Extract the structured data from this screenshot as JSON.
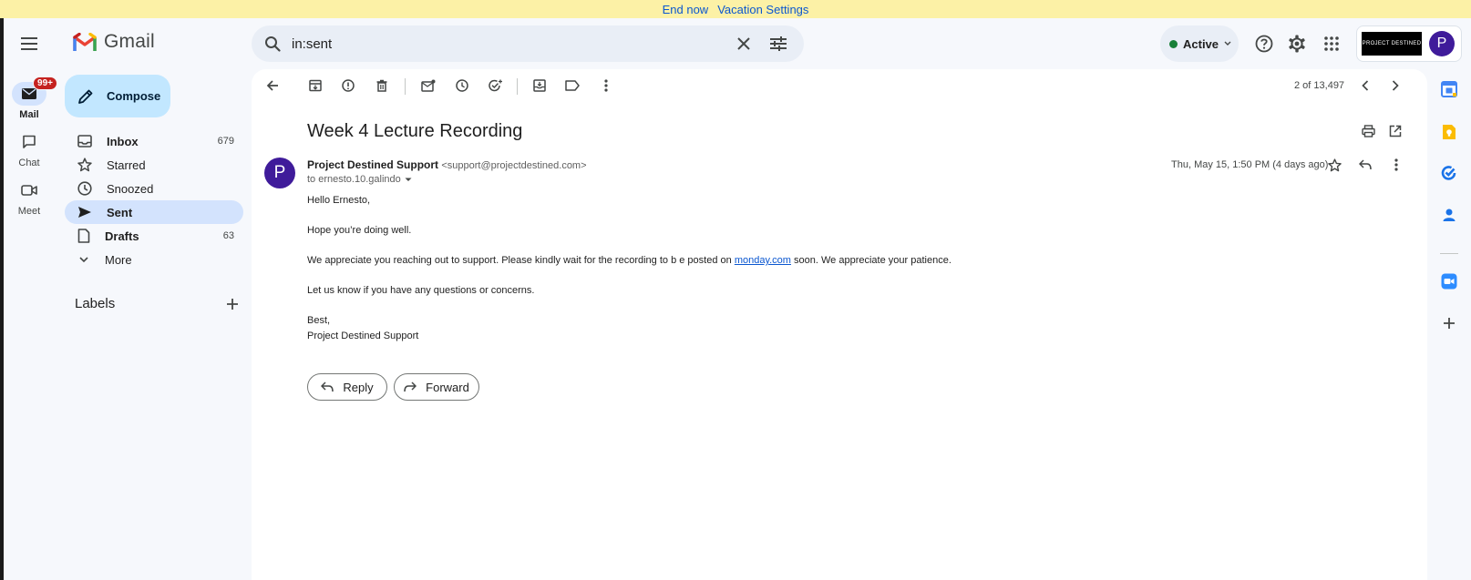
{
  "banner": {
    "end_now": "End now",
    "vacation_settings": "Vacation Settings"
  },
  "header": {
    "logo_text": "Gmail",
    "search": {
      "value": "in:sent"
    },
    "status": "Active",
    "org_logo_text": "PROJECT DESTINED",
    "avatar_letter": "P"
  },
  "rail": [
    {
      "label": "Mail",
      "badge": "99+"
    },
    {
      "label": "Chat"
    },
    {
      "label": "Meet"
    }
  ],
  "compose_label": "Compose",
  "nav": [
    {
      "label": "Inbox",
      "count": "679"
    },
    {
      "label": "Starred",
      "count": ""
    },
    {
      "label": "Snoozed",
      "count": ""
    },
    {
      "label": "Sent",
      "count": ""
    },
    {
      "label": "Drafts",
      "count": "63"
    },
    {
      "label": "More",
      "count": ""
    }
  ],
  "labels_heading": "Labels",
  "toolbar": {
    "pager": "2 of 13,497"
  },
  "email": {
    "subject": "Week 4 Lecture Recording",
    "sender_initial": "P",
    "sender_name": "Project Destined Support",
    "sender_email": "<support@projectdestined.com>",
    "to": "to ernesto.10.galindo",
    "date": "Thu, May 15, 1:50 PM (4 days ago)",
    "greeting": "Hello Ernesto,",
    "line1": "Hope you’re doing well.",
    "line2_before": "We appreciate you reaching out to support. Please kindly wait for the recording to b e posted on ",
    "line2_link": "monday.com",
    "line2_after": " soon. We appreciate your patience.",
    "line3": "Let us know if you have any questions or concerns.",
    "signoff": "Best,",
    "signature": "Project Destined Support"
  },
  "actions": {
    "reply": "Reply",
    "forward": "Forward"
  },
  "colors": {
    "accent": "#0b57d0",
    "compose_bg": "#c2e7ff",
    "active_nav": "#d3e3fd",
    "banner": "#fcf1a6",
    "avatar": "#3f1b9a"
  }
}
